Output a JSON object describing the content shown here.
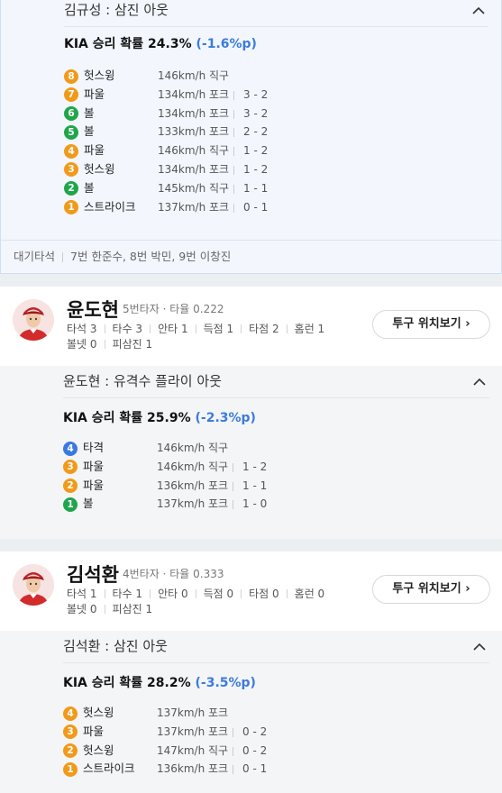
{
  "team": "KIA",
  "prob_suffix": "승리 확률",
  "colors": {
    "accent_blue": "#3b7be0",
    "ball_green": "#1fa64b",
    "pitch_orange": "#f19a1a",
    "hit_blue": "#3a79e0"
  },
  "top": {
    "result": "김규성 : 삼진 아웃",
    "prob_label": "KIA 승리 확률",
    "prob_value": "24.3%",
    "prob_delta": "(-1.6%p)",
    "pitches": [
      {
        "n": "8",
        "color": "orange",
        "result": "헛스윙",
        "speed": "146km/h 직구",
        "count": ""
      },
      {
        "n": "7",
        "color": "orange",
        "result": "파울",
        "speed": "134km/h 포크",
        "count": "3 - 2"
      },
      {
        "n": "6",
        "color": "green",
        "result": "볼",
        "speed": "134km/h 포크",
        "count": "3 - 2"
      },
      {
        "n": "5",
        "color": "green",
        "result": "볼",
        "speed": "133km/h 포크",
        "count": "2 - 2"
      },
      {
        "n": "4",
        "color": "orange",
        "result": "파울",
        "speed": "146km/h 직구",
        "count": "1 - 2"
      },
      {
        "n": "3",
        "color": "orange",
        "result": "헛스윙",
        "speed": "134km/h 포크",
        "count": "1 - 2"
      },
      {
        "n": "2",
        "color": "green",
        "result": "볼",
        "speed": "145km/h 직구",
        "count": "1 - 1"
      },
      {
        "n": "1",
        "color": "orange",
        "result": "스트라이크",
        "speed": "137km/h 포크",
        "count": "0 - 1"
      }
    ],
    "waiting_label": "대기타석",
    "waiting_value": "7번 한준수, 8번 박민, 9번 이창진"
  },
  "players": [
    {
      "name": "윤도현",
      "order": "5번타자",
      "avg_label": "타율",
      "avg": "0.222",
      "stats": [
        "타석 3",
        "타수 3",
        "안타 1",
        "득점 1",
        "타점 2",
        "홈런 1",
        "볼넷 0",
        "피삼진 1"
      ],
      "button": "투구 위치보기",
      "result": "윤도현 : 유격수 플라이 아웃",
      "prob_label": "KIA 승리 확률",
      "prob_value": "25.9%",
      "prob_delta": "(-2.3%p)",
      "pitches": [
        {
          "n": "4",
          "color": "blue",
          "result": "타격",
          "speed": "146km/h 직구",
          "count": ""
        },
        {
          "n": "3",
          "color": "orange",
          "result": "파울",
          "speed": "146km/h 직구",
          "count": "1 - 2"
        },
        {
          "n": "2",
          "color": "orange",
          "result": "파울",
          "speed": "136km/h 포크",
          "count": "1 - 1"
        },
        {
          "n": "1",
          "color": "green",
          "result": "볼",
          "speed": "137km/h 포크",
          "count": "1 - 0"
        }
      ]
    },
    {
      "name": "김석환",
      "order": "4번타자",
      "avg_label": "타율",
      "avg": "0.333",
      "stats": [
        "타석 1",
        "타수 1",
        "안타 0",
        "득점 0",
        "타점 0",
        "홈런 0",
        "볼넷 0",
        "피삼진 1"
      ],
      "button": "투구 위치보기",
      "result": "김석환 : 삼진 아웃",
      "prob_label": "KIA 승리 확률",
      "prob_value": "28.2%",
      "prob_delta": "(-3.5%p)",
      "pitches": [
        {
          "n": "4",
          "color": "orange",
          "result": "헛스윙",
          "speed": "137km/h 포크",
          "count": ""
        },
        {
          "n": "3",
          "color": "orange",
          "result": "파울",
          "speed": "137km/h 포크",
          "count": "0 - 2"
        },
        {
          "n": "2",
          "color": "orange",
          "result": "헛스윙",
          "speed": "147km/h 직구",
          "count": "0 - 2"
        },
        {
          "n": "1",
          "color": "orange",
          "result": "스트라이크",
          "speed": "136km/h 포크",
          "count": "0 - 1"
        }
      ]
    }
  ]
}
